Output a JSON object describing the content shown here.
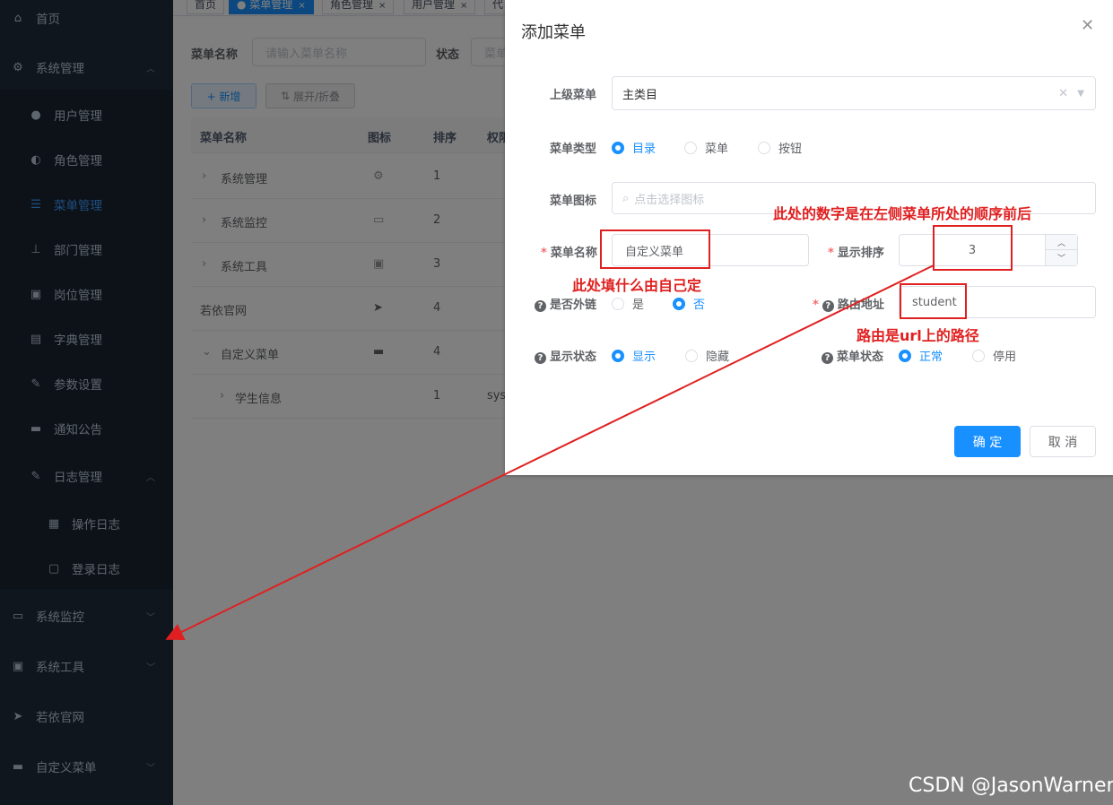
{
  "sidebar": {
    "home": "首页",
    "system": "系统管理",
    "user": "用户管理",
    "role": "角色管理",
    "menu": "菜单管理",
    "dept": "部门管理",
    "post": "岗位管理",
    "dict": "字典管理",
    "config": "参数设置",
    "notice": "通知公告",
    "log": "日志管理",
    "oplog": "操作日志",
    "loginlog": "登录日志",
    "monitor": "系统监控",
    "tool": "系统工具",
    "ruoyi": "若依官网",
    "custom": "自定义菜单"
  },
  "tabs": [
    "首页",
    "菜单管理",
    "角色管理",
    "用户管理",
    "代"
  ],
  "search": {
    "name_label": "菜单名称",
    "name_placeholder": "请输入菜单名称",
    "status_label": "状态",
    "status_placeholder": "菜单",
    "add_button": "+ 新增",
    "expand_button": "展开/折叠"
  },
  "table": {
    "headers": [
      "菜单名称",
      "图标",
      "排序",
      "权限"
    ],
    "rows": [
      {
        "name": "系统管理",
        "order": "1",
        "perm": ""
      },
      {
        "name": "系统监控",
        "order": "2",
        "perm": ""
      },
      {
        "name": "系统工具",
        "order": "3",
        "perm": ""
      },
      {
        "name": "若依官网",
        "order": "4",
        "perm": ""
      },
      {
        "name": "自定义菜单",
        "order": "4",
        "perm": ""
      },
      {
        "name": "学生信息",
        "order": "1",
        "perm": "sys"
      }
    ]
  },
  "dialog": {
    "title": "添加菜单",
    "parent_label": "上级菜单",
    "parent_value": "主类目",
    "type_label": "菜单类型",
    "type_options": [
      "目录",
      "菜单",
      "按钮"
    ],
    "icon_label": "菜单图标",
    "icon_placeholder": "点击选择图标",
    "name_label": "菜单名称",
    "name_value": "自定义菜单",
    "order_label": "显示排序",
    "order_value": "3",
    "external_label": "是否外链",
    "external_options": [
      "是",
      "否"
    ],
    "route_label": "路由地址",
    "route_value": "student",
    "visible_label": "显示状态",
    "visible_options": [
      "显示",
      "隐藏"
    ],
    "status_label": "菜单状态",
    "status_options": [
      "正常",
      "停用"
    ],
    "ok_button": "确 定",
    "cancel_button": "取 消"
  },
  "annotations": {
    "order_note": "此处的数字是在左侧菜单所处的顺序前后",
    "name_note": "此处填什么由自己定",
    "route_note": "路由是url上的路径"
  },
  "watermark": "CSDN @JasonWarner",
  "colors": {
    "sidebar": "#1f2d3d",
    "accent": "#1890ff",
    "annotation": "#e02020"
  }
}
